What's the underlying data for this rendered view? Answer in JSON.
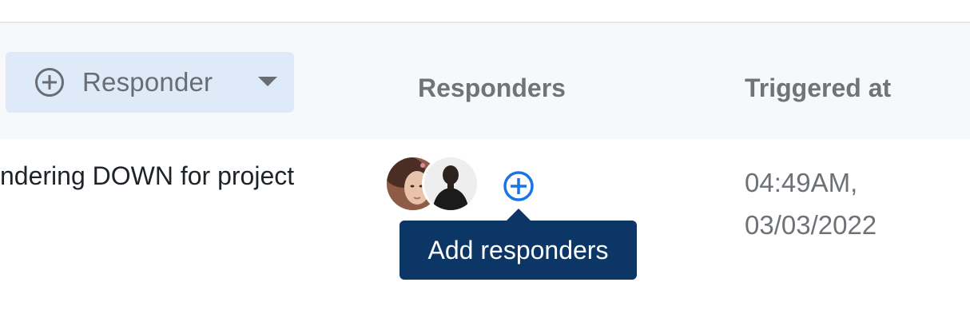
{
  "filter": {
    "label": "Responder",
    "icon": "plus-circle-icon"
  },
  "columns": {
    "responders": "Responders",
    "triggered_at": "Triggered at"
  },
  "row": {
    "title": "ndering DOWN for project",
    "responders": [
      {
        "name": "",
        "icon": "avatar"
      },
      {
        "name": "",
        "icon": "avatar"
      }
    ],
    "add_responder_tooltip": "Add responders",
    "triggered_time": "04:49AM,",
    "triggered_date": "03/03/2022"
  },
  "colors": {
    "accent": "#1a74e8",
    "tooltip_bg": "#0c3666",
    "filter_bg": "#dfeaf8"
  }
}
